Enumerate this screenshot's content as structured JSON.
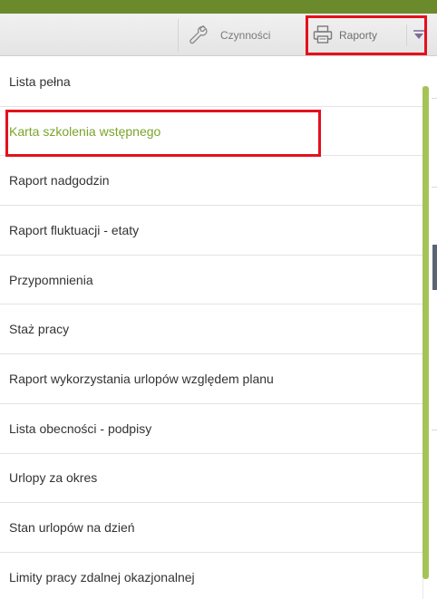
{
  "toolbar": {
    "czynnosci_label": "Czynności",
    "raporty_label": "Raporty",
    "icons": {
      "czynnosci": "wrench-icon",
      "raporty": "printer-icon",
      "dropdown": "dropdown-arrow-icon"
    }
  },
  "menu": {
    "items": [
      {
        "label": "Lista pełna"
      },
      {
        "label": "Karta szkolenia wstępnego",
        "active": true
      },
      {
        "label": "Raport nadgodzin"
      },
      {
        "label": "Raport fluktuacji - etaty"
      },
      {
        "label": "Przypomnienia"
      },
      {
        "label": "Staż pracy"
      },
      {
        "label": "Raport wykorzystania urlopów względem planu"
      },
      {
        "label": "Lista obecności - podpisy"
      },
      {
        "label": "Urlopy za okres"
      },
      {
        "label": "Stan urlopów na dzień"
      },
      {
        "label": "Limity pracy zdalnej okazjonalnej"
      }
    ]
  },
  "colors": {
    "topbar": "#6b8a2c",
    "active_item": "#7aa52a",
    "scrollbar": "#a6c455",
    "highlight": "#e5101c"
  }
}
